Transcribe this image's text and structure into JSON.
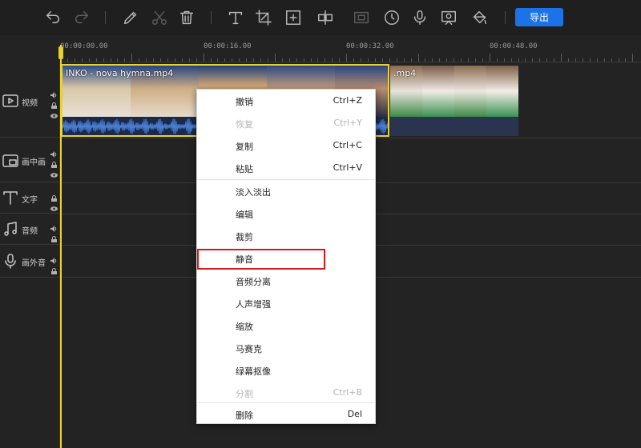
{
  "toolbar": {
    "export_label": "导出",
    "icons": [
      "undo-icon",
      "redo-icon",
      "pencil-icon",
      "scissors-icon",
      "trash-icon",
      "text-icon",
      "crop-icon",
      "add-frame-icon",
      "split-icon",
      "freeze-icon",
      "clock-icon",
      "microphone-icon",
      "screen-record-icon",
      "paint-bucket-icon"
    ]
  },
  "ruler": {
    "labels": [
      "00:00:00.00",
      "00:00:16.00",
      "00:00:32.00",
      "00:00:48.00"
    ]
  },
  "tracks": [
    {
      "label": "视频",
      "icon": "video-icon"
    },
    {
      "label": "画中画",
      "icon": "pip-icon"
    },
    {
      "label": "文字",
      "icon": "text-track-icon"
    },
    {
      "label": "音频",
      "icon": "music-icon"
    },
    {
      "label": "画外音",
      "icon": "voiceover-icon"
    }
  ],
  "clips": {
    "clip1_name": "INKO - nova hymna.mp4",
    "clip2_name": "    .mp4"
  },
  "context_menu": {
    "items": [
      {
        "label": "撤销",
        "shortcut": "Ctrl+Z",
        "disabled": false
      },
      {
        "label": "恢复",
        "shortcut": "Ctrl+Y",
        "disabled": true
      },
      {
        "label": "复制",
        "shortcut": "Ctrl+C",
        "disabled": false
      },
      {
        "label": "粘贴",
        "shortcut": "Ctrl+V",
        "disabled": false
      },
      {
        "label": "淡入淡出",
        "shortcut": "",
        "disabled": false
      },
      {
        "label": "编辑",
        "shortcut": "",
        "disabled": false
      },
      {
        "label": "裁剪",
        "shortcut": "",
        "disabled": false
      },
      {
        "label": "静音",
        "shortcut": "",
        "disabled": false
      },
      {
        "label": "音频分离",
        "shortcut": "",
        "disabled": false
      },
      {
        "label": "人声增强",
        "shortcut": "",
        "disabled": false
      },
      {
        "label": "缩放",
        "shortcut": "",
        "disabled": false
      },
      {
        "label": "马赛克",
        "shortcut": "",
        "disabled": false
      },
      {
        "label": "绿幕抠像",
        "shortcut": "",
        "disabled": false
      },
      {
        "label": "分割",
        "shortcut": "Ctrl+B",
        "disabled": true
      },
      {
        "label": "删除",
        "shortcut": "Del",
        "disabled": false
      }
    ],
    "highlighted": "静音"
  },
  "colors": {
    "accent": "#1c73e8",
    "playhead": "#e8d233",
    "highlight_box": "#d71818"
  }
}
